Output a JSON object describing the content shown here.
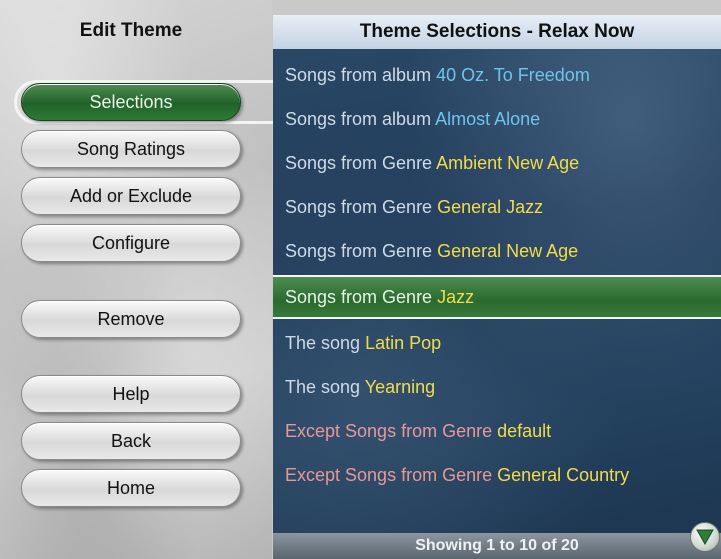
{
  "left_panel": {
    "title": "Edit Theme",
    "buttons": [
      {
        "label": "Selections",
        "selected": true
      },
      {
        "label": "Song Ratings",
        "selected": false
      },
      {
        "label": "Add or Exclude",
        "selected": false
      },
      {
        "label": "Configure",
        "selected": false
      },
      {
        "label": "Remove",
        "selected": false
      },
      {
        "label": "Help",
        "selected": false
      },
      {
        "label": "Back",
        "selected": false
      },
      {
        "label": "Home",
        "selected": false
      }
    ]
  },
  "right_panel": {
    "title": "Theme Selections - Relax Now",
    "rows": [
      {
        "prefix": "Songs from album",
        "value": "40 Oz. To Freedom",
        "value_color": "blue",
        "kind": "include",
        "selected": false
      },
      {
        "prefix": "Songs from album",
        "value": "Almost Alone",
        "value_color": "blue",
        "kind": "include",
        "selected": false
      },
      {
        "prefix": "Songs from Genre",
        "value": "Ambient New Age",
        "value_color": "yellow",
        "kind": "include",
        "selected": false
      },
      {
        "prefix": "Songs from Genre",
        "value": "General Jazz",
        "value_color": "yellow",
        "kind": "include",
        "selected": false
      },
      {
        "prefix": "Songs from Genre",
        "value": "General New Age",
        "value_color": "yellow",
        "kind": "include",
        "selected": false
      },
      {
        "prefix": "Songs from Genre",
        "value": "Jazz",
        "value_color": "yellow",
        "kind": "include",
        "selected": true
      },
      {
        "prefix": "The song",
        "value": "Latin Pop",
        "value_color": "yellow",
        "kind": "include",
        "selected": false
      },
      {
        "prefix": "The song",
        "value": "Yearning",
        "value_color": "yellow",
        "kind": "include",
        "selected": false
      },
      {
        "prefix": "Except Songs from Genre",
        "value": "default",
        "value_color": "yellow",
        "kind": "exclude",
        "selected": false
      },
      {
        "prefix": "Except Songs from Genre",
        "value": "General Country",
        "value_color": "yellow",
        "kind": "exclude",
        "selected": false
      }
    ],
    "footer": "Showing 1 to 10 of 20",
    "scroll_icon": "down-arrow-icon"
  },
  "colors": {
    "selected_green": "#2a6a2f",
    "list_background": "#1f3a58",
    "value_blue": "#6fc4ee",
    "value_yellow": "#f3dc4a",
    "exclude_pink": "#e79898"
  }
}
